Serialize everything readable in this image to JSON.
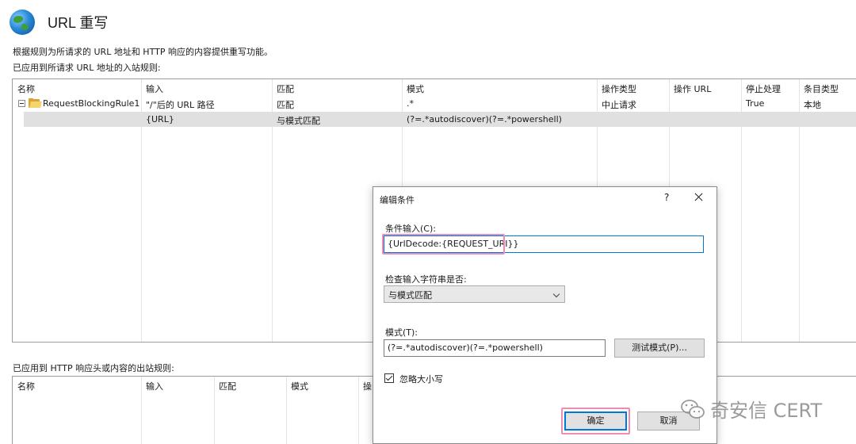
{
  "header": {
    "title": "URL 重写",
    "icon": "globe-icon"
  },
  "description": "根据规则为所请求的 URL 地址和 HTTP 响应的内容提供重写功能。",
  "inbound": {
    "label": "已应用到所请求 URL 地址的入站规则:",
    "columns": [
      "名称",
      "输入",
      "匹配",
      "模式",
      "操作类型",
      "操作 URL",
      "停止处理",
      "条目类型"
    ],
    "rule": {
      "name": "RequestBlockingRule1",
      "input": "\"/\"后的 URL 路径",
      "match": "匹配",
      "pattern": ".*",
      "action_type": "中止请求",
      "action_url": "",
      "stop": "True",
      "entry_type": "本地"
    },
    "condition": {
      "input": "{URL}",
      "match": "与模式匹配",
      "pattern": "(?=.*autodiscover)(?=.*powershell)"
    }
  },
  "outbound": {
    "label": "已应用到 HTTP 响应头或内容的出站规则:",
    "columns": [
      "名称",
      "输入",
      "匹配",
      "模式",
      "操"
    ]
  },
  "dialog": {
    "title": "编辑条件",
    "help": "?",
    "condition_input_label": "条件输入(C):",
    "condition_input_value": "{UrlDecode:{REQUEST_URI}}",
    "check_label": "检查输入字符串是否:",
    "check_value": "与模式匹配",
    "pattern_label": "模式(T):",
    "pattern_value": "(?=.*autodiscover)(?=.*powershell)",
    "test_button": "测试模式(P)...",
    "ignore_case_label": "忽略大小写",
    "ignore_case_checked": true,
    "ok_button": "确定",
    "cancel_button": "取消"
  },
  "watermark": {
    "text": "奇安信 CERT"
  },
  "colors": {
    "highlight_border": "#f08cb4",
    "focus_blue": "#0078d7",
    "row_selected": "#e0e0e0"
  }
}
